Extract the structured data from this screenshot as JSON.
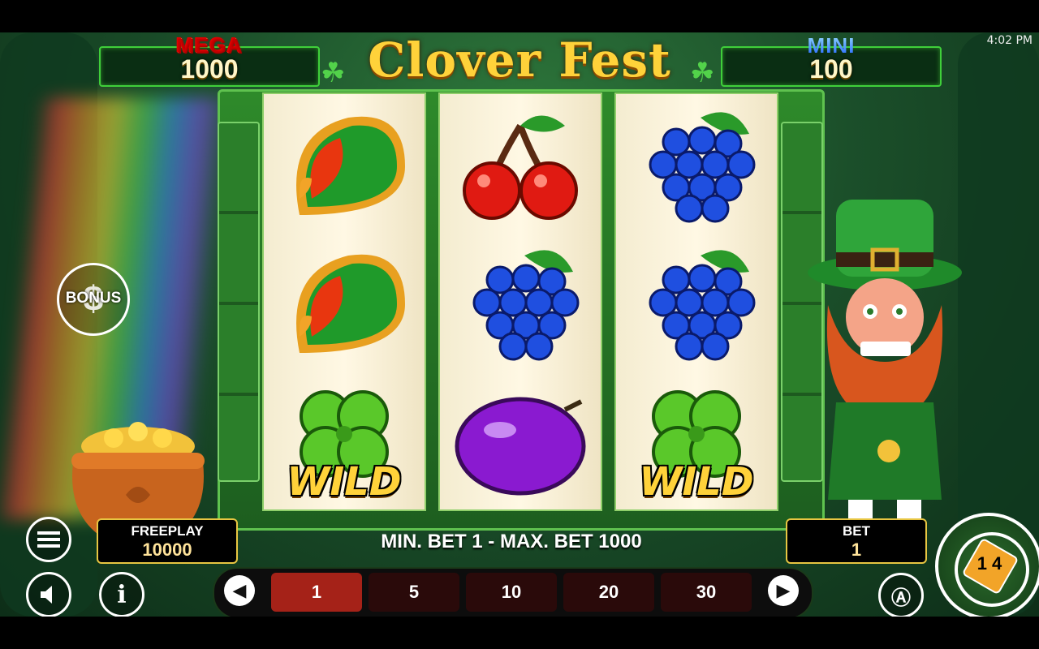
{
  "status": {
    "time": "4:02 PM"
  },
  "jackpots": {
    "mega": {
      "label": "MEGA",
      "value": "1000"
    },
    "mini": {
      "label": "MINI",
      "value": "100"
    }
  },
  "title": "Clover Fest",
  "bonus": {
    "label": "BONUS",
    "symbol": "$"
  },
  "reels": [
    [
      "watermelon",
      "watermelon",
      "clover-wild"
    ],
    [
      "cherry",
      "grapes",
      "plum"
    ],
    [
      "grapes",
      "grapes",
      "clover-wild"
    ]
  ],
  "wild_label": "WILD",
  "freeplay": {
    "label": "FREEPLAY",
    "value": "10000"
  },
  "bet": {
    "label": "BET",
    "value": "1"
  },
  "limits": "MIN. BET 1 - MAX. BET 1000",
  "bet_options": [
    "1",
    "5",
    "10",
    "20",
    "30"
  ],
  "selected_bet": "1",
  "spin_logo": "1 4",
  "icons": {
    "menu": "menu-icon",
    "sound": "speaker-icon",
    "info": "info-icon",
    "auto": "autoplay-icon",
    "prev": "chevron-left-icon",
    "next": "chevron-right-icon"
  },
  "colors": {
    "accent_gold": "#e8c642",
    "selected_chip": "#a52218",
    "frame_green": "#2e8a2a"
  }
}
